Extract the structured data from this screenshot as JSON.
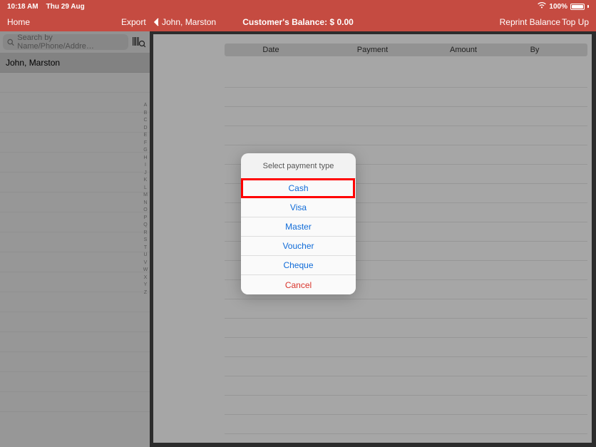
{
  "status": {
    "time": "10:18 AM",
    "date": "Thu 29 Aug",
    "battery": "100%"
  },
  "nav": {
    "home": "Home",
    "export": "Export",
    "back_customer": "John, Marston",
    "balance_label": "Customer's Balance: $ 0.00",
    "reprint": "Reprint Balance",
    "topup": "Top Up"
  },
  "search": {
    "placeholder": "Search by Name/Phone/Addre…"
  },
  "customer_list": {
    "selected": "John, Marston"
  },
  "index_letters": [
    "A",
    "B",
    "C",
    "D",
    "E",
    "F",
    "G",
    "H",
    "I",
    "J",
    "K",
    "L",
    "M",
    "N",
    "O",
    "P",
    "Q",
    "R",
    "S",
    "T",
    "U",
    "V",
    "W",
    "X",
    "Y",
    "Z"
  ],
  "tx_table": {
    "col_date": "Date",
    "col_payment": "Payment",
    "col_amount": "Amount",
    "col_by": "By"
  },
  "sheet": {
    "title": "Select payment type",
    "cash": "Cash",
    "visa": "Visa",
    "master": "Master",
    "voucher": "Voucher",
    "cheque": "Cheque",
    "cancel": "Cancel"
  }
}
